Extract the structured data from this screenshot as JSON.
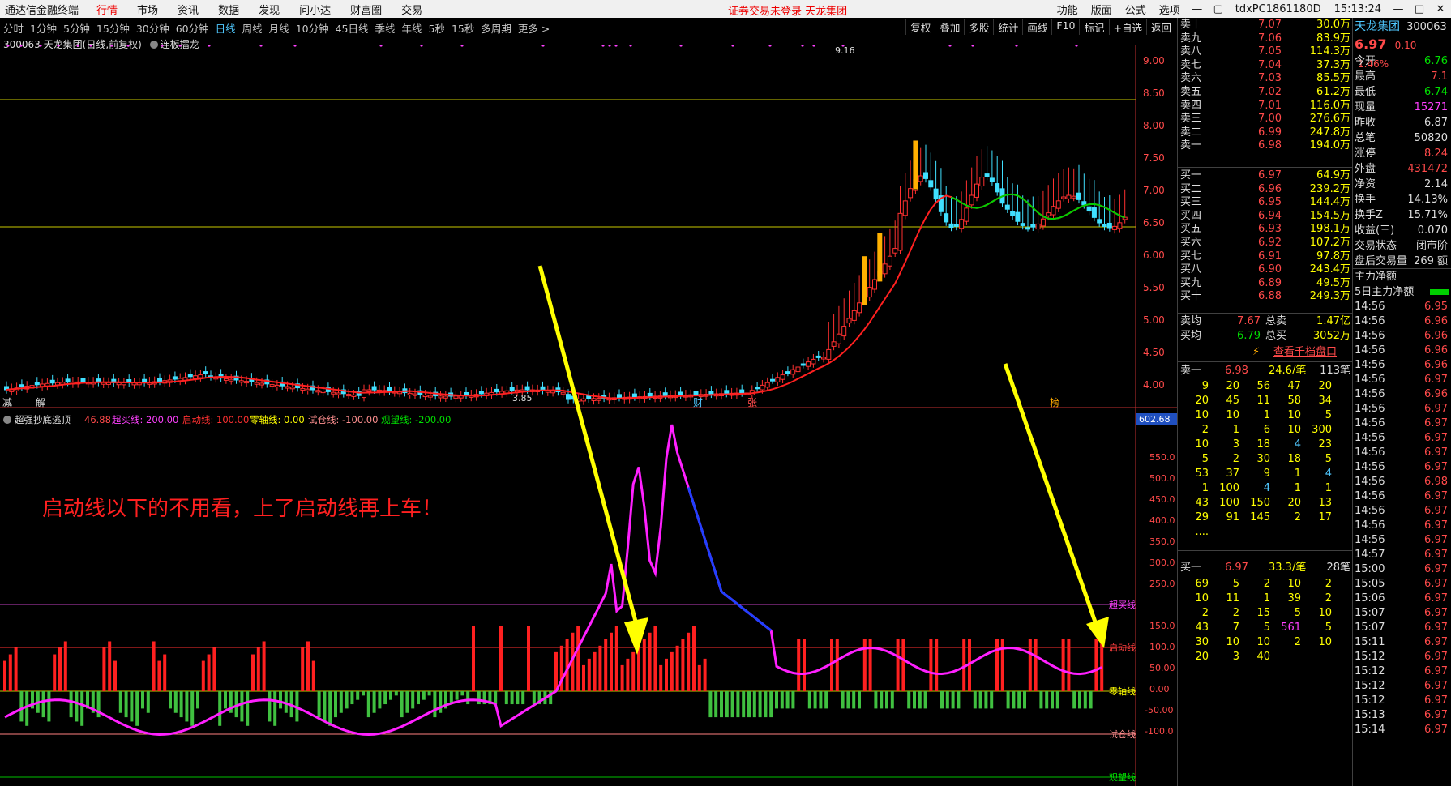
{
  "menubar": {
    "app": "通达信金融终端",
    "menus": [
      "行情",
      "市场",
      "资讯",
      "数据",
      "发现",
      "问小达",
      "财富圈",
      "交易"
    ],
    "warning": "证券交易未登录  天龙集团",
    "right": [
      "功能",
      "版面",
      "公式",
      "选项"
    ],
    "account": "tdxPC1861180D",
    "clock": "15:13:24"
  },
  "toolbar": {
    "periods": [
      "分时",
      "1分钟",
      "5分钟",
      "15分钟",
      "30分钟",
      "60分钟",
      "日线",
      "周线",
      "月线",
      "10分钟",
      "45日线",
      "季线",
      "年线",
      "5秒",
      "15秒",
      "多周期",
      "更多 >"
    ],
    "selected": "日线",
    "right": [
      "复权",
      "叠加",
      "多股",
      "统计",
      "画线",
      "F10",
      "标记",
      "+自选",
      "返回"
    ]
  },
  "title": {
    "code": "300063",
    "name": "天龙集团(日线,前复权)",
    "strategy": "连板擂龙"
  },
  "price_chart": {
    "y_ticks": [
      "9.00",
      "8.50",
      "8.00",
      "7.50",
      "7.00",
      "6.50",
      "6.00",
      "5.50",
      "5.00",
      "4.50",
      "4.00"
    ],
    "high_label": "9.16",
    "low_label": "3.85",
    "event_labels": [
      "减",
      "解",
      "财",
      "张",
      "榜"
    ]
  },
  "indicator": {
    "name": "超强抄底逃顶",
    "value": "46.88",
    "lines": [
      {
        "label": "超买线: 200.00",
        "color": "#ff40ff"
      },
      {
        "label": "启动线: 100.00",
        "color": "#ff3030"
      },
      {
        "label": "零轴线: 0.00",
        "color": "#ffff00"
      },
      {
        "label": "试仓线: -100.00",
        "color": "#ff9090"
      },
      {
        "label": "观望线: -200.00",
        "color": "#00e000"
      }
    ],
    "scale_max": "602.68",
    "y_ticks": [
      "550.0",
      "500.0",
      "450.0",
      "400.0",
      "350.0",
      "300.0",
      "250.0",
      "150.0",
      "100.0",
      "50.00",
      "0.00",
      "-50.00",
      "-100.0"
    ],
    "line_tags": [
      "超买线",
      "启动线",
      "零轴线",
      "试仓线",
      "观望线"
    ],
    "annotation": "启动线以下的不用看，上了启动线再上车！"
  },
  "quote": {
    "sell": [
      {
        "label": "卖十",
        "price": "7.07",
        "vol": "30.0万"
      },
      {
        "label": "卖九",
        "price": "7.06",
        "vol": "83.9万"
      },
      {
        "label": "卖八",
        "price": "7.05",
        "vol": "114.3万"
      },
      {
        "label": "卖七",
        "price": "7.04",
        "vol": "37.3万"
      },
      {
        "label": "卖六",
        "price": "7.03",
        "vol": "85.5万"
      },
      {
        "label": "卖五",
        "price": "7.02",
        "vol": "61.2万"
      },
      {
        "label": "卖四",
        "price": "7.01",
        "vol": "116.0万"
      },
      {
        "label": "卖三",
        "price": "7.00",
        "vol": "276.6万"
      },
      {
        "label": "卖二",
        "price": "6.99",
        "vol": "247.8万"
      },
      {
        "label": "卖一",
        "price": "6.98",
        "vol": "194.0万"
      }
    ],
    "buy": [
      {
        "label": "买一",
        "price": "6.97",
        "vol": "64.9万"
      },
      {
        "label": "买二",
        "price": "6.96",
        "vol": "239.2万"
      },
      {
        "label": "买三",
        "price": "6.95",
        "vol": "144.4万"
      },
      {
        "label": "买四",
        "price": "6.94",
        "vol": "154.5万"
      },
      {
        "label": "买五",
        "price": "6.93",
        "vol": "198.1万"
      },
      {
        "label": "买六",
        "price": "6.92",
        "vol": "107.2万"
      },
      {
        "label": "买七",
        "price": "6.91",
        "vol": "97.8万"
      },
      {
        "label": "买八",
        "price": "6.90",
        "vol": "243.4万"
      },
      {
        "label": "买九",
        "price": "6.89",
        "vol": "49.5万"
      },
      {
        "label": "买十",
        "price": "6.88",
        "vol": "249.3万"
      }
    ],
    "avg_sell": {
      "label": "卖均",
      "price": "7.67",
      "tlabel": "总卖",
      "total": "1.47亿"
    },
    "avg_buy": {
      "label": "买均",
      "price": "6.79",
      "tlabel": "总买",
      "total": "3052万"
    },
    "view_button": "查看千档盘口",
    "sell1_queue": {
      "label": "卖一",
      "price": "6.98",
      "per": "24.6/笔",
      "count": "113笔"
    },
    "sell1_orders": [
      [
        "9",
        "20",
        "56",
        "47",
        "20"
      ],
      [
        "20",
        "45",
        "11",
        "58",
        "34"
      ],
      [
        "10",
        "10",
        "1",
        "10",
        "5"
      ],
      [
        "2",
        "1",
        "6",
        "10",
        "300"
      ],
      [
        "10",
        "3",
        "18",
        "4",
        "23"
      ],
      [
        "5",
        "2",
        "30",
        "18",
        "5"
      ],
      [
        "53",
        "37",
        "9",
        "1",
        "4"
      ],
      [
        "1",
        "100",
        "4",
        "1",
        "1"
      ],
      [
        "43",
        "100",
        "150",
        "20",
        "13"
      ],
      [
        "29",
        "91",
        "145",
        "2",
        "17"
      ],
      [
        "....",
        "",
        "",
        "",
        ""
      ]
    ],
    "buy1_queue": {
      "label": "买一",
      "price": "6.97",
      "per": "33.3/笔",
      "count": "28笔"
    },
    "buy1_orders": [
      [
        "69",
        "5",
        "2",
        "10",
        "2"
      ],
      [
        "10",
        "11",
        "1",
        "39",
        "2"
      ],
      [
        "2",
        "2",
        "15",
        "5",
        "10"
      ],
      [
        "43",
        "7",
        "5",
        "561",
        "5"
      ],
      [
        "30",
        "10",
        "10",
        "2",
        "10"
      ],
      [
        "20",
        "3",
        "40",
        "",
        ""
      ]
    ]
  },
  "info": {
    "name": "天龙集团",
    "code": "300063",
    "price": "6.97",
    "change": "0.10",
    "pct": "1.46%",
    "rows": [
      {
        "label": "今开",
        "value": "6.76",
        "color": "green"
      },
      {
        "label": "最高",
        "value": "7.1",
        "color": "red"
      },
      {
        "label": "最低",
        "value": "6.74",
        "color": "green"
      },
      {
        "label": "现量",
        "value": "15271",
        "color": "purple"
      },
      {
        "label": "昨收",
        "value": "6.87",
        "color": "white"
      },
      {
        "label": "总笔",
        "value": "50820",
        "color": "white"
      },
      {
        "label": "涨停",
        "value": "8.24",
        "color": "red"
      },
      {
        "label": "外盘",
        "value": "431472",
        "color": "red"
      },
      {
        "label": "净资",
        "value": "2.14",
        "color": "white"
      },
      {
        "label": "换手",
        "value": "14.13%",
        "color": "white"
      },
      {
        "label": "换手Z",
        "value": "15.71%",
        "color": "white"
      },
      {
        "label": "收益(三)",
        "value": "0.070",
        "color": "white"
      },
      {
        "label": "交易状态",
        "value": "闭市阶",
        "color": "white"
      },
      {
        "label": "盘后交易量",
        "value": "269 额",
        "color": "white"
      },
      {
        "label": "主力净额",
        "value": "",
        "color": "white"
      },
      {
        "label": "5日主力净额",
        "value": "",
        "color": "white"
      }
    ],
    "ticks": [
      {
        "t": "14:56",
        "p": "6.95"
      },
      {
        "t": "14:56",
        "p": "6.96"
      },
      {
        "t": "14:56",
        "p": "6.96"
      },
      {
        "t": "14:56",
        "p": "6.96"
      },
      {
        "t": "14:56",
        "p": "6.96"
      },
      {
        "t": "14:56",
        "p": "6.97"
      },
      {
        "t": "14:56",
        "p": "6.96"
      },
      {
        "t": "14:56",
        "p": "6.97"
      },
      {
        "t": "14:56",
        "p": "6.97"
      },
      {
        "t": "14:56",
        "p": "6.97"
      },
      {
        "t": "14:56",
        "p": "6.97"
      },
      {
        "t": "14:56",
        "p": "6.97"
      },
      {
        "t": "14:56",
        "p": "6.98"
      },
      {
        "t": "14:56",
        "p": "6.97"
      },
      {
        "t": "14:56",
        "p": "6.97"
      },
      {
        "t": "14:56",
        "p": "6.97"
      },
      {
        "t": "14:56",
        "p": "6.97"
      },
      {
        "t": "14:57",
        "p": "6.97"
      },
      {
        "t": "15:00",
        "p": "6.97"
      },
      {
        "t": "15:05",
        "p": "6.97"
      },
      {
        "t": "15:06",
        "p": "6.97"
      },
      {
        "t": "15:07",
        "p": "6.97"
      },
      {
        "t": "15:07",
        "p": "6.97"
      },
      {
        "t": "15:11",
        "p": "6.97"
      },
      {
        "t": "15:12",
        "p": "6.97"
      },
      {
        "t": "15:12",
        "p": "6.97"
      },
      {
        "t": "15:12",
        "p": "6.97"
      },
      {
        "t": "15:12",
        "p": "6.97"
      },
      {
        "t": "15:13",
        "p": "6.97"
      },
      {
        "t": "15:14",
        "p": "6.97"
      }
    ]
  }
}
